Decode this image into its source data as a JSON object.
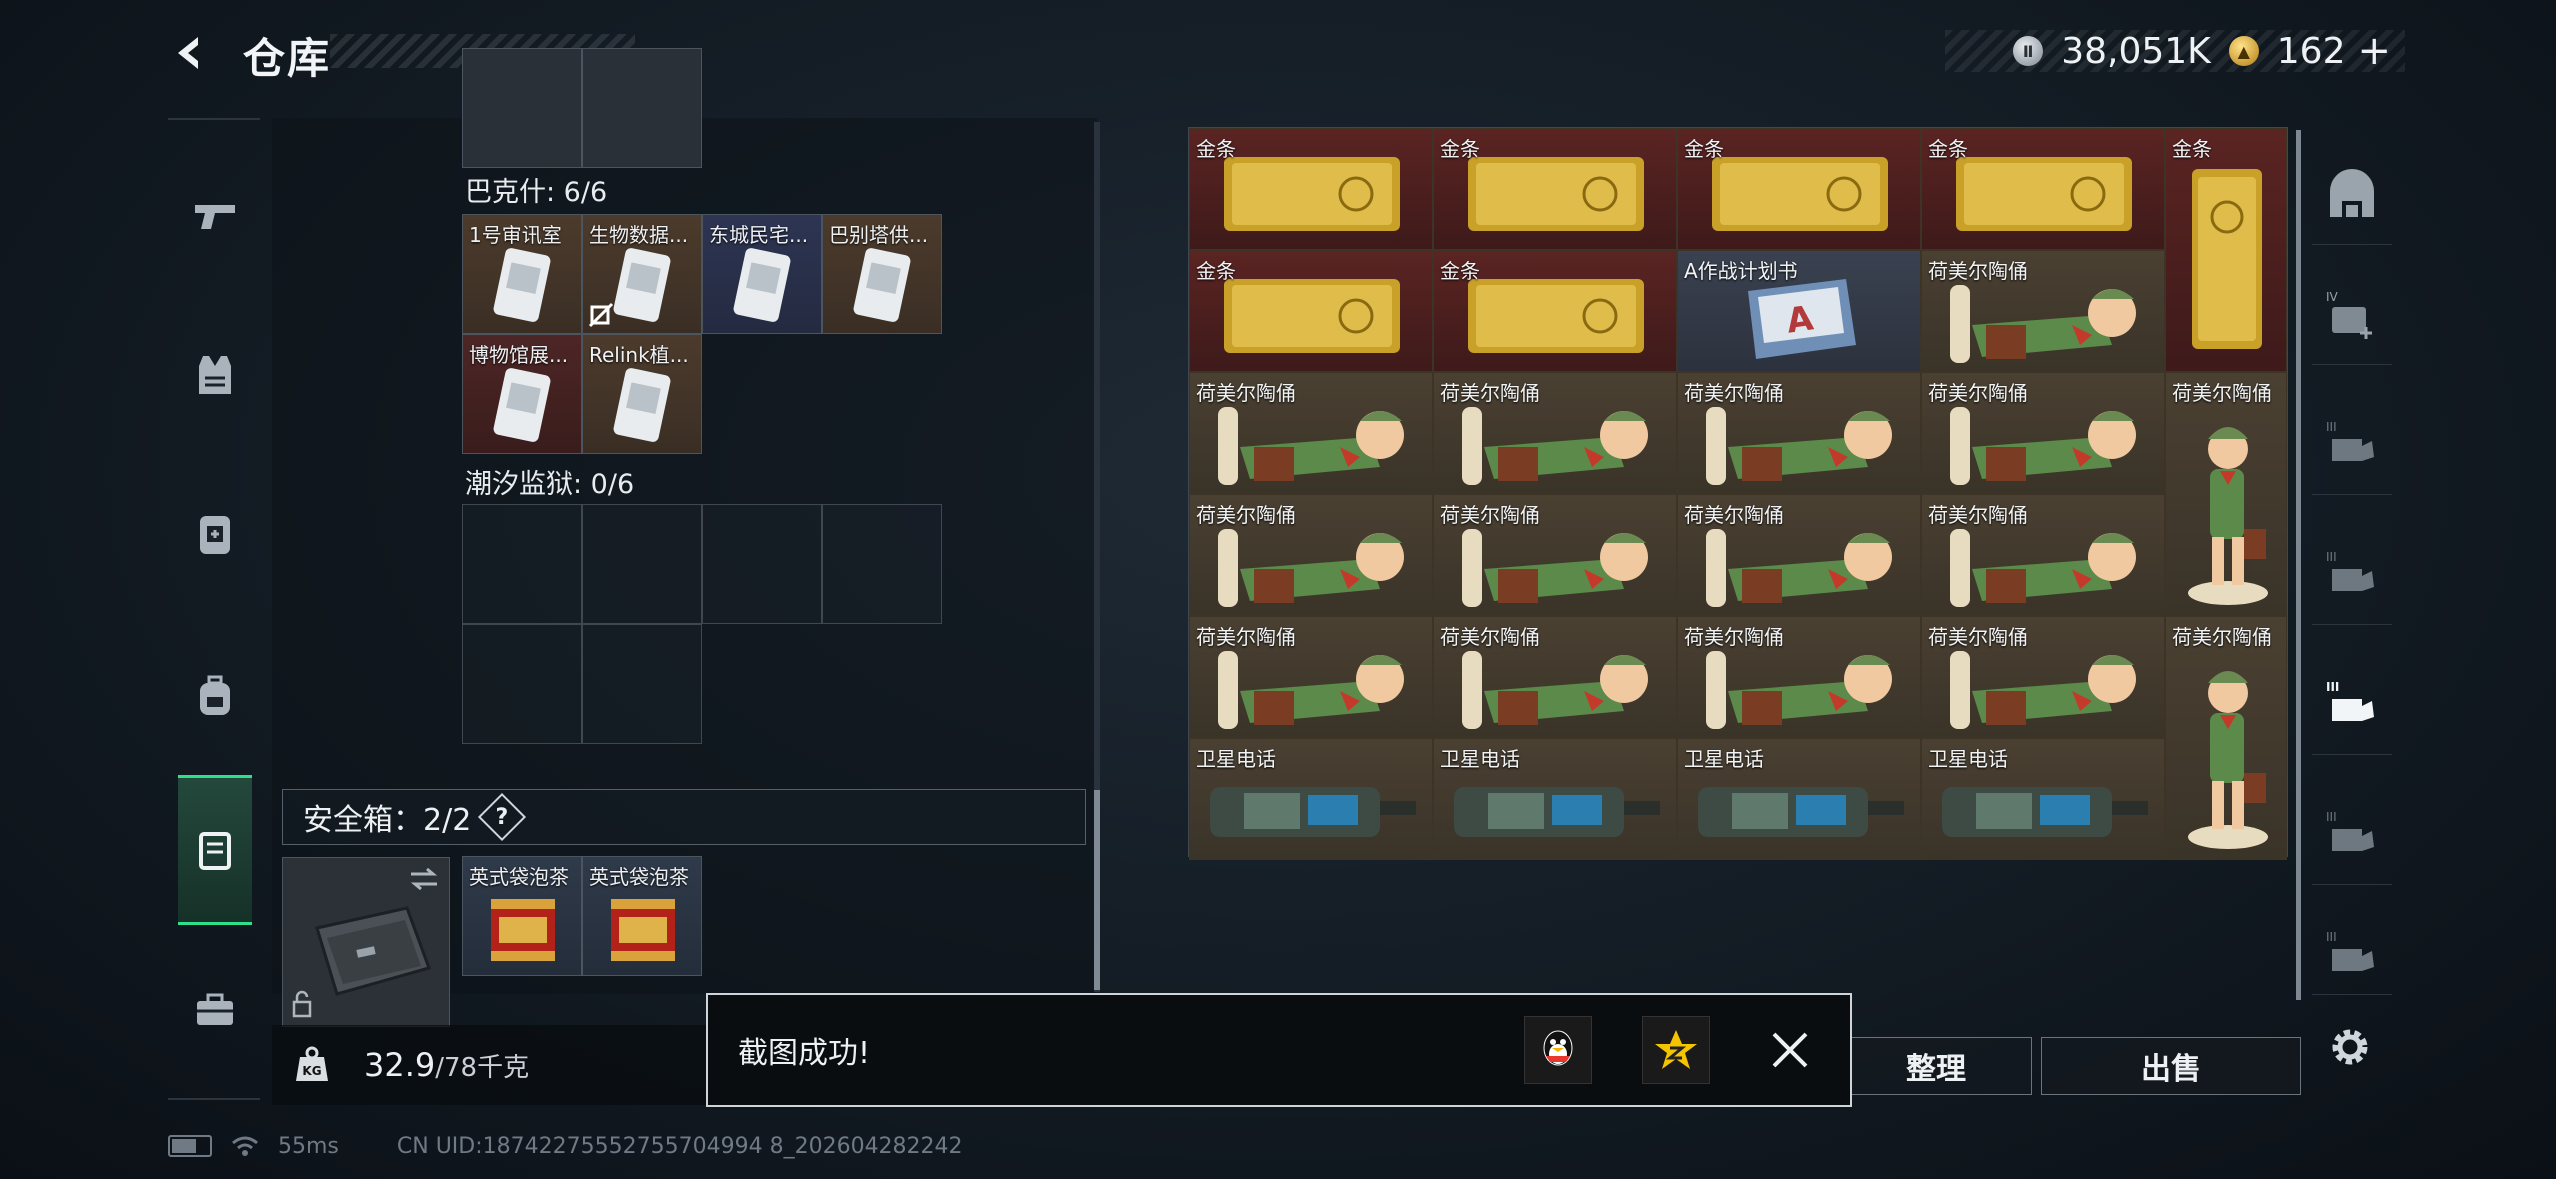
{
  "header": {
    "title": "仓库",
    "currency_silver": "38,051K",
    "currency_gold": "162",
    "plus": "+"
  },
  "left_panel": {
    "sections": [
      {
        "label": "巴克什: 6/6",
        "items": [
          "1号审讯室",
          "生物数据...",
          "东城民宅...",
          "巴别塔供...",
          "博物馆展...",
          "Relink植..."
        ]
      },
      {
        "label": "潮汐监狱: 0/6"
      }
    ],
    "safe_box": {
      "title": "安全箱：2/2",
      "help": "?",
      "items": [
        "英式袋泡茶",
        "英式袋泡茶"
      ]
    }
  },
  "weight": {
    "current": "32.9",
    "max": "/78千克",
    "icon_text": "KG"
  },
  "stash": {
    "items": {
      "gold": "金条",
      "plan": "A作战计划书",
      "figurine": "荷美尔陶俑",
      "phone": "卫星电话"
    }
  },
  "buttons": {
    "sort": "整理",
    "sell": "出售"
  },
  "toast": {
    "message": "截图成功!"
  },
  "footer": {
    "ping": "55ms",
    "uid": "CN UID:18742275552755704994 8_202604282242"
  },
  "colors": {
    "accent_green": "#2ee08c",
    "gold_cell": "#5a2422",
    "olive_cell": "#4a4032"
  }
}
